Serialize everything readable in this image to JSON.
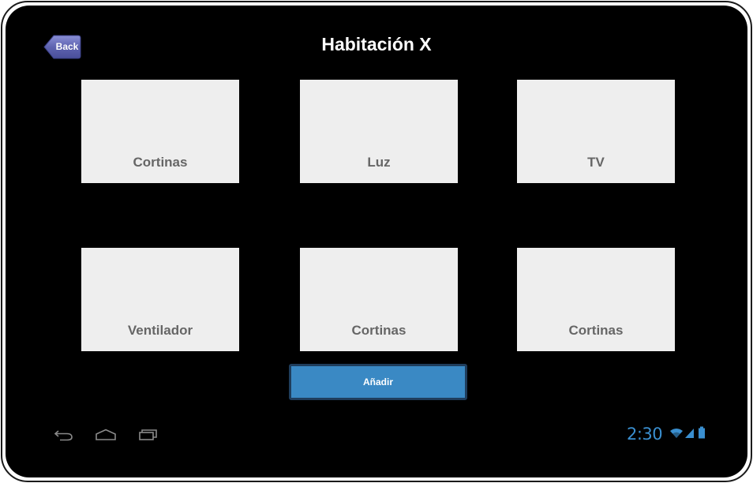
{
  "header": {
    "back_label": "Back",
    "title": "Habitación X"
  },
  "tiles": [
    {
      "label": "Cortinas"
    },
    {
      "label": "Luz"
    },
    {
      "label": "TV"
    },
    {
      "label": "Ventilador"
    },
    {
      "label": "Cortinas"
    },
    {
      "label": "Cortinas"
    }
  ],
  "actions": {
    "add_label": "Añadir"
  },
  "status_bar": {
    "time": "2:30",
    "icons": [
      "wifi-icon",
      "signal-icon",
      "battery-icon"
    ]
  },
  "nav_bar": {
    "icons": [
      "back-nav-icon",
      "home-nav-icon",
      "recent-apps-icon"
    ]
  },
  "colors": {
    "screen_background": "#000000",
    "tile_background": "#eeeeee",
    "tile_text": "#666666",
    "add_button": "#3a89c4",
    "back_button": "#5e63b0",
    "status_accent": "#3a8fd0"
  }
}
